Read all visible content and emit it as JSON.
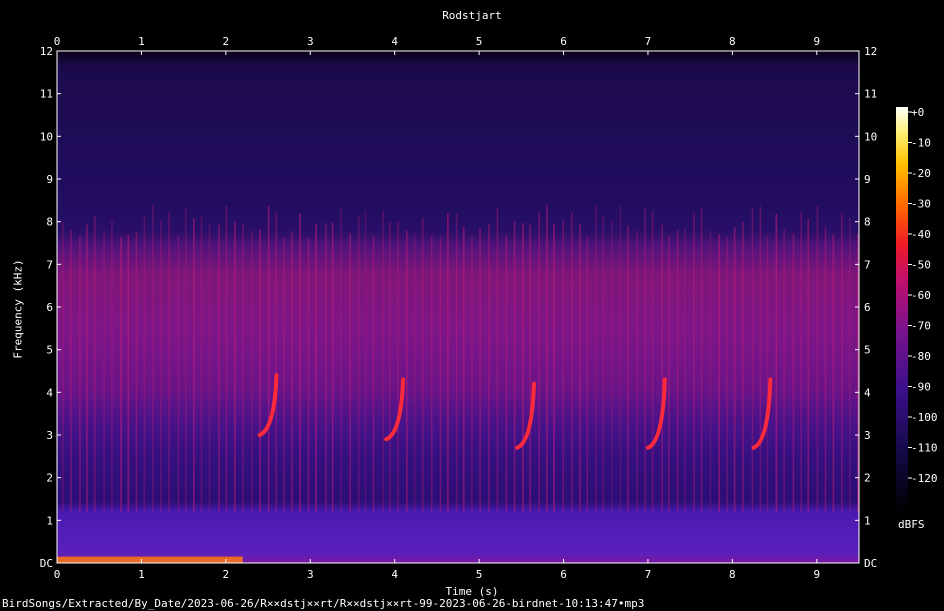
{
  "title": "Rodstjart",
  "footer": "BirdSongs/Extracted/By_Date/2023-06-26/R××dstj××rt/R××dstj××rt-99-2023-06-26-birdnet-10:13:47•mp3",
  "colorbar_unit": "dBFS",
  "chart_data": {
    "type": "heatmap",
    "subtype": "spectrogram",
    "title": "Rodstjart",
    "xlabel": "Time (s)",
    "ylabel": "Frequency (kHz)",
    "xlim": [
      0,
      9.5
    ],
    "ylim": [
      0,
      12
    ],
    "x_ticks": [
      "0",
      "1",
      "2",
      "3",
      "4",
      "5",
      "6",
      "7",
      "8",
      "9"
    ],
    "y_ticks": [
      "DC",
      "1",
      "2",
      "3",
      "4",
      "5",
      "6",
      "7",
      "8",
      "9",
      "10",
      "11",
      "12"
    ],
    "colorbar": {
      "label": "dBFS",
      "ticks": [
        "+0",
        "-10",
        "-20",
        "-30",
        "-40",
        "-50",
        "-60",
        "-70",
        "-80",
        "-90",
        "-100",
        "-110",
        "-120"
      ],
      "range": [
        -120,
        0
      ]
    },
    "signal_bands_khz": [
      [
        0,
        1.2
      ],
      [
        1.2,
        7.6
      ],
      [
        7.6,
        11.6
      ]
    ],
    "song_phrases": [
      {
        "t_start": 2.4,
        "t_end": 2.6,
        "f_low": 3.0,
        "f_high": 4.4
      },
      {
        "t_start": 3.9,
        "t_end": 4.1,
        "f_low": 2.9,
        "f_high": 4.3
      },
      {
        "t_start": 5.45,
        "t_end": 5.65,
        "f_low": 2.7,
        "f_high": 4.2
      },
      {
        "t_start": 7.0,
        "t_end": 7.2,
        "f_low": 2.7,
        "f_high": 4.3
      },
      {
        "t_start": 8.25,
        "t_end": 8.45,
        "f_low": 2.7,
        "f_high": 4.3
      }
    ],
    "low_frequency_hum": {
      "t_start": 0.0,
      "t_end": 2.2,
      "f_low": 0.0,
      "f_high": 0.15
    }
  }
}
